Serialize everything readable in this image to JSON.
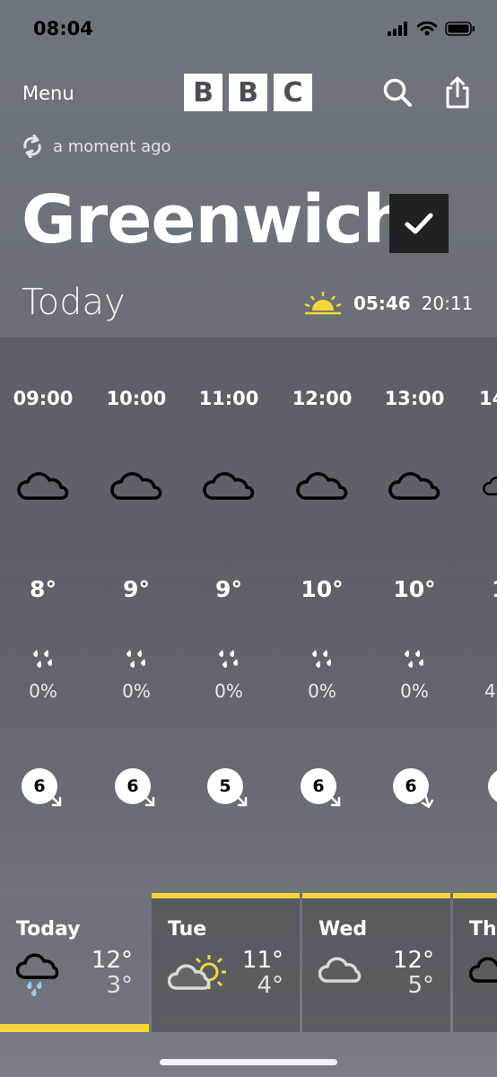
{
  "status_bar": {
    "time": "08:04",
    "icons": [
      "signal-icon",
      "wifi-icon",
      "battery-icon"
    ]
  },
  "header": {
    "menu_label": "Menu",
    "logo_letters": [
      "B",
      "B",
      "C"
    ],
    "icons": [
      "search-icon",
      "share-icon"
    ]
  },
  "updated": {
    "icon": "refresh-icon",
    "text": "a moment ago"
  },
  "location": {
    "name": "Greenwich",
    "check_icon": "check-icon"
  },
  "today": {
    "label": "Today",
    "sunrise": "05:46",
    "sunset": "20:11",
    "sun_icon": "sunrise-icon"
  },
  "hourly": [
    {
      "time": "09:00",
      "icon": "cloud-icon",
      "temp": "8°",
      "rain": "0%",
      "wind": "6"
    },
    {
      "time": "10:00",
      "icon": "cloud-icon",
      "temp": "9°",
      "rain": "0%",
      "wind": "6"
    },
    {
      "time": "11:00",
      "icon": "cloud-icon",
      "temp": "9°",
      "rain": "0%",
      "wind": "5"
    },
    {
      "time": "12:00",
      "icon": "cloud-icon",
      "temp": "10°",
      "rain": "0%",
      "wind": "6"
    },
    {
      "time": "13:00",
      "icon": "cloud-icon",
      "temp": "10°",
      "rain": "0%",
      "wind": "6"
    },
    {
      "time": "14",
      "icon": "cloud-icon",
      "temp": "1",
      "rain": "4",
      "wind": ""
    }
  ],
  "days": [
    {
      "name": "Today",
      "icon": "rain-cloud-icon",
      "high": "12°",
      "low": "3°",
      "selected": true
    },
    {
      "name": "Tue",
      "icon": "sun-cloud-icon",
      "high": "11°",
      "low": "4°",
      "selected": false
    },
    {
      "name": "Wed",
      "icon": "cloud-icon",
      "high": "12°",
      "low": "5°",
      "selected": false
    },
    {
      "name": "Thu",
      "icon": "cloud-icon",
      "high": "",
      "low": "",
      "selected": false
    }
  ],
  "colors": {
    "accent": "#f5d53c",
    "dark_box": "#1f2124",
    "background": "#6a7076"
  }
}
